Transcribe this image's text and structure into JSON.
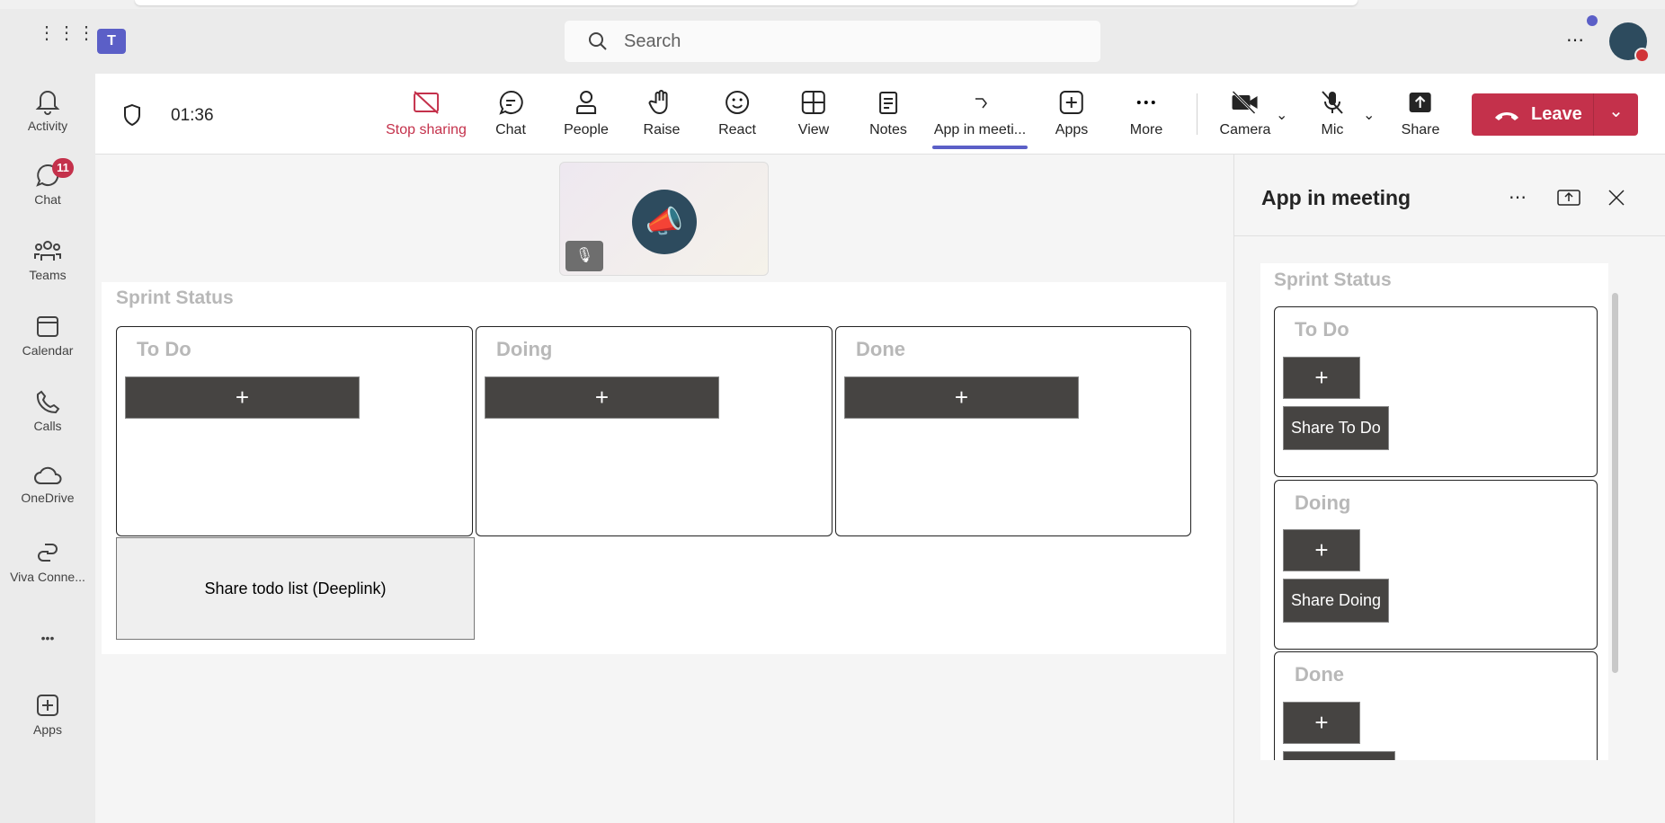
{
  "titlebar": {
    "search_placeholder": "Search",
    "more": "⋯"
  },
  "rail": [
    {
      "label": "Activity",
      "icon": "bell-icon"
    },
    {
      "label": "Chat",
      "icon": "chat-icon",
      "badge": "11"
    },
    {
      "label": "Teams",
      "icon": "teams-icon"
    },
    {
      "label": "Calendar",
      "icon": "calendar-icon"
    },
    {
      "label": "Calls",
      "icon": "phone-icon"
    },
    {
      "label": "OneDrive",
      "icon": "cloud-icon"
    },
    {
      "label": "Viva Conne...",
      "icon": "viva-icon"
    },
    {
      "label": "•••",
      "icon": "more-icon"
    },
    {
      "label": "Apps",
      "icon": "apps-icon"
    }
  ],
  "toolbar": {
    "timer": "01:36",
    "items": [
      "Stop sharing",
      "Chat",
      "People",
      "Raise",
      "React",
      "View",
      "Notes",
      "App in meeti...",
      "Apps",
      "More",
      "Camera",
      "Mic",
      "Share"
    ],
    "leave": "Leave",
    "accent": "#5b5fc7",
    "stop_color": "#c4314b"
  },
  "stage": {
    "title": "Sprint Status",
    "columns": [
      {
        "title": "To Do",
        "add": "+"
      },
      {
        "title": "Doing",
        "add": "+"
      },
      {
        "title": "Done",
        "add": "+"
      }
    ],
    "share_deeplink": "Share todo list (Deeplink)"
  },
  "panel": {
    "title": "App in meeting",
    "more": "⋯",
    "content_title": "Sprint Status",
    "cards": [
      {
        "title": "To Do",
        "add": "+",
        "share": "Share To Do"
      },
      {
        "title": "Doing",
        "add": "+",
        "share": "Share Doing"
      },
      {
        "title": "Done",
        "add": "+"
      }
    ]
  }
}
